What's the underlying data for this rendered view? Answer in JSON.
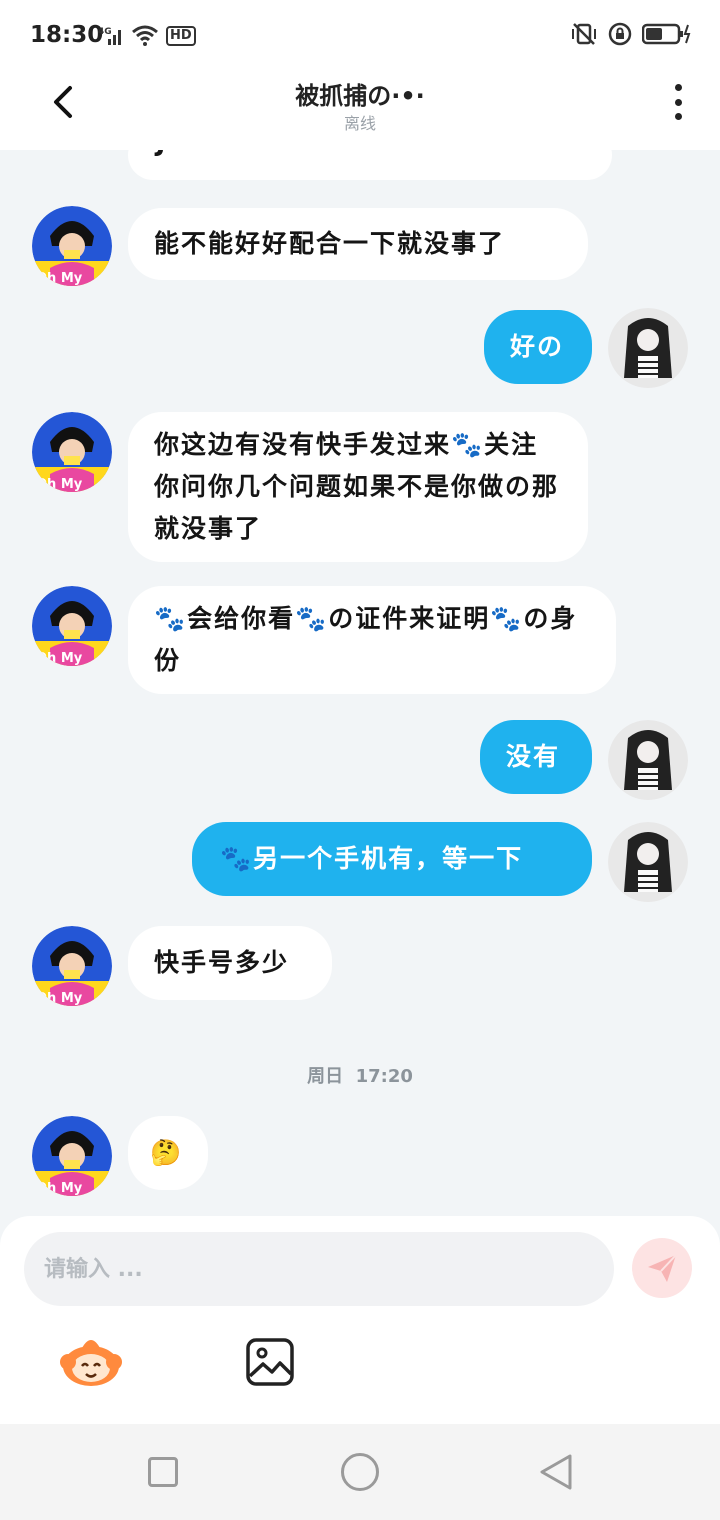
{
  "status_bar": {
    "time": "18:30",
    "network": "4G",
    "wifi_badge": "HD"
  },
  "header": {
    "title": "被抓捕の·•·",
    "subtitle": "离线"
  },
  "messages": [
    {
      "side": "in",
      "text": "J"
    },
    {
      "side": "in",
      "text": "能不能好好配合一下就没事了"
    },
    {
      "side": "out",
      "text": "好の"
    },
    {
      "side": "in",
      "text": "你这边有没有快手发过来🐾关注你问你几个问题如果不是你做の那就没事了"
    },
    {
      "side": "in",
      "text": "🐾会给你看🐾の证件来证明🐾の身份"
    },
    {
      "side": "out",
      "text": "没有"
    },
    {
      "side": "out",
      "text": "🐾另一个手机有，等一下"
    },
    {
      "side": "in",
      "text": "快手号多少"
    },
    {
      "side": "in",
      "text": "🤔"
    }
  ],
  "timestamp": {
    "day": "周日",
    "time": "17:20"
  },
  "avatar_left": {
    "caption": "Oh My"
  },
  "input": {
    "placeholder": "请输入 ..."
  },
  "colors": {
    "accent": "#1fb2ee",
    "incoming_bubble": "#ffffff",
    "background": "#f2f5f7"
  },
  "icons": [
    "back-arrow-icon",
    "more-vert-icon",
    "send-icon",
    "emoji-icon",
    "image-icon",
    "nav-recents-icon",
    "nav-home-icon",
    "nav-back-icon"
  ]
}
